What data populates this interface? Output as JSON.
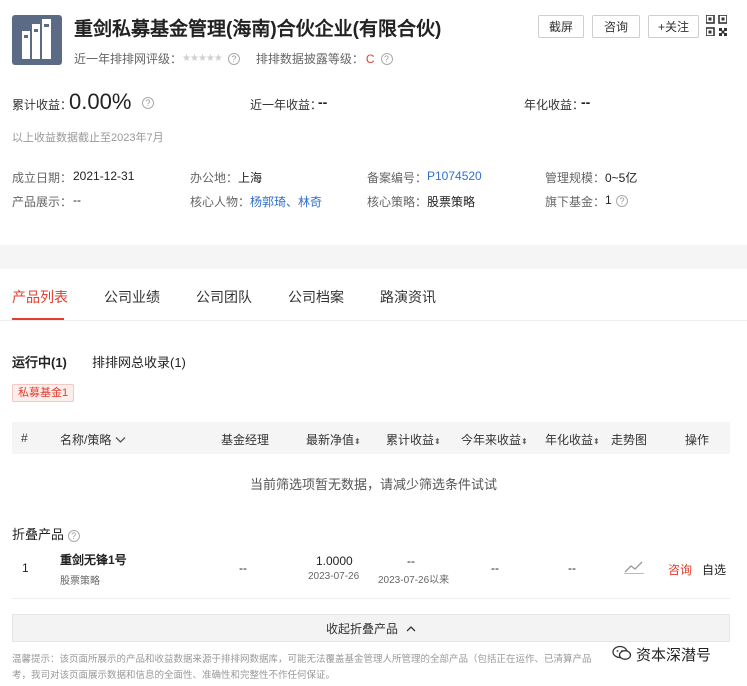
{
  "header": {
    "company_name": "重剑私募基金管理(海南)合伙企业(有限合伙)",
    "buttons": {
      "screenshot": "截屏",
      "consult": "咨询",
      "follow": "+关注"
    },
    "rating_label": "近一年排排网评级：",
    "disclosure_label": "排排数据披露等级：",
    "disclosure_grade": "C"
  },
  "returns": {
    "cumulative_label": "累计收益：",
    "cumulative_value": "0.00%",
    "year_label": "近一年收益：",
    "year_value": "--",
    "annual_label": "年化收益：",
    "annual_value": "--",
    "note": "以上收益数据截止至2023年7月"
  },
  "info": {
    "founded_label": "成立日期：",
    "founded_value": "2021-12-31",
    "office_label": "办公地：",
    "office_value": "上海",
    "record_label": "备案编号：",
    "record_value": "P1074520",
    "scale_label": "管理规模：",
    "scale_value": "0~5亿",
    "products_label": "产品展示：",
    "products_value": "--",
    "people_label": "核心人物：",
    "person1": "杨郭琦",
    "sep": "、",
    "person2": "林奇",
    "strategy_label": "核心策略：",
    "strategy_value": "股票策略",
    "funds_label": "旗下基金：",
    "funds_value": "1"
  },
  "tabs": [
    "产品列表",
    "公司业绩",
    "公司团队",
    "公司档案",
    "路演资讯"
  ],
  "subtabs": {
    "running": "运行中(1)",
    "collected": "排排网总收录(1)"
  },
  "tag": "私募基金1",
  "table": {
    "headers": {
      "idx": "#",
      "name": "名称/策略",
      "manager": "基金经理",
      "nav": "最新净值",
      "cum": "累计收益",
      "ytd": "今年来收益",
      "annual": "年化收益",
      "trend": "走势图",
      "op": "操作"
    },
    "empty_text": "当前筛选项暂无数据，请减少筛选条件试试"
  },
  "folded": {
    "title": "折叠产品",
    "row": {
      "idx": "1",
      "name": "重剑无锋1号",
      "strategy": "股票策略",
      "manager": "--",
      "nav": "1.0000",
      "nav_date": "2023-07-26",
      "cum": "--",
      "cum_note": "2023-07-26以来",
      "ytd": "--",
      "annual": "--",
      "consult": "咨询",
      "select": "自选"
    },
    "collapse_label": "收起折叠产品"
  },
  "footer": {
    "line1": "温馨提示：该页面所展示的产品和收益数据来源于排排网数据库，可能无法覆盖基金管理人所管理的全部产品（包括正在运作、已清算产品",
    "line2": "考，我司对该页面展示数据和信息的全面性、准确性和完整性不作任何保证。"
  },
  "watermark": "资本深潜号",
  "colors": {
    "accent": "#e23d2e",
    "link": "#2f6fd0",
    "logo": "#5b6b86"
  }
}
